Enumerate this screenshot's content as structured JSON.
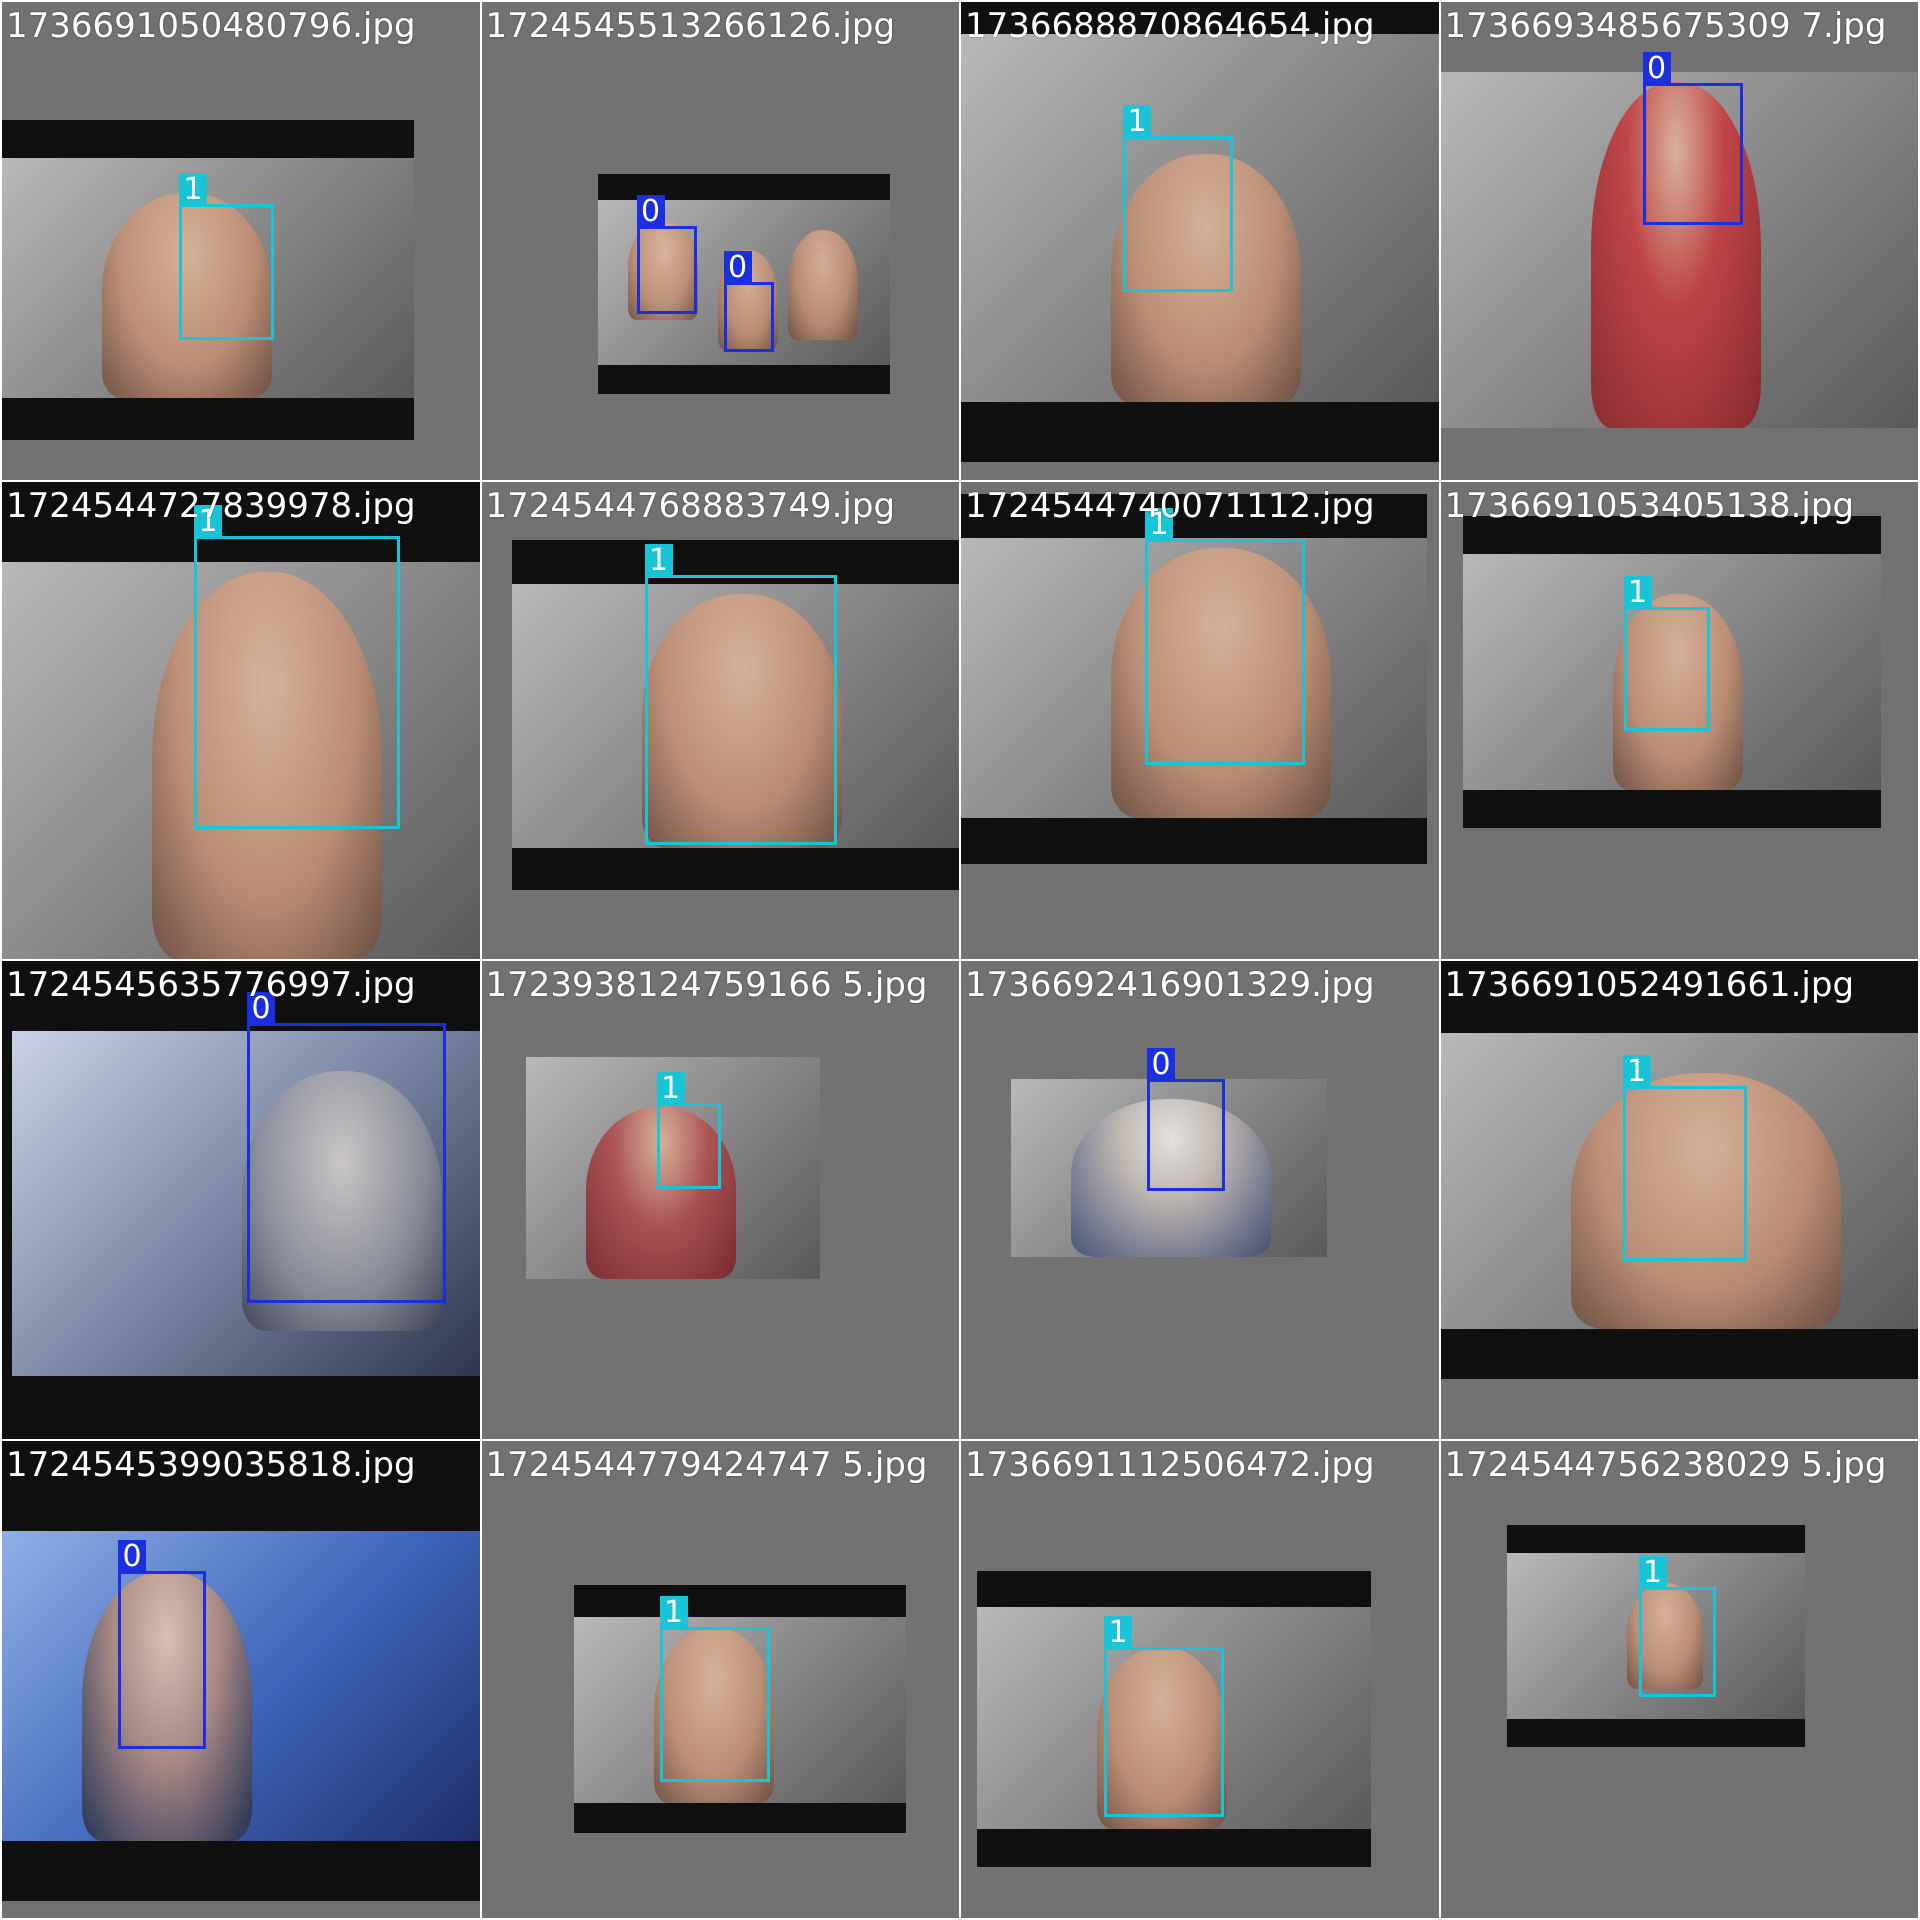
{
  "colors": {
    "class_0": "#1a2fe0",
    "class_1": "#19c4d6",
    "caption_text": "#ffffff",
    "tile_background": "#727272",
    "letterbox": "#101010"
  },
  "tiles": [
    {
      "filename": "1736691050480796.jpg",
      "boxes": [
        {
          "label": "1"
        }
      ]
    },
    {
      "filename": "1724545513266126.jpg",
      "boxes": [
        {
          "label": "0"
        },
        {
          "label": "0"
        }
      ]
    },
    {
      "filename": "1736688870864654.jpg",
      "boxes": [
        {
          "label": "1"
        }
      ]
    },
    {
      "filename": "1736693485675309 7.jpg",
      "boxes": [
        {
          "label": "0"
        }
      ]
    },
    {
      "filename": "1724544727839978.jpg",
      "boxes": [
        {
          "label": "1"
        }
      ]
    },
    {
      "filename": "1724544768883749.jpg",
      "boxes": [
        {
          "label": "1"
        }
      ]
    },
    {
      "filename": "1724544740071112.jpg",
      "boxes": [
        {
          "label": "1"
        }
      ]
    },
    {
      "filename": "1736691053405138.jpg",
      "boxes": [
        {
          "label": "1"
        }
      ]
    },
    {
      "filename": "1724545635776997.jpg",
      "boxes": [
        {
          "label": "0"
        }
      ]
    },
    {
      "filename": "1723938124759166 5.jpg",
      "boxes": [
        {
          "label": "1"
        }
      ]
    },
    {
      "filename": "1736692416901329.jpg",
      "boxes": [
        {
          "label": "0"
        }
      ]
    },
    {
      "filename": "1736691052491661.jpg",
      "boxes": [
        {
          "label": "1"
        }
      ]
    },
    {
      "filename": "1724545399035818.jpg",
      "boxes": [
        {
          "label": "0"
        }
      ]
    },
    {
      "filename": "1724544779424747 5.jpg",
      "boxes": [
        {
          "label": "1"
        }
      ]
    },
    {
      "filename": "1736691112506472.jpg",
      "boxes": [
        {
          "label": "1"
        }
      ]
    },
    {
      "filename": "1724544756238029 5.jpg",
      "boxes": [
        {
          "label": "1"
        }
      ]
    }
  ]
}
